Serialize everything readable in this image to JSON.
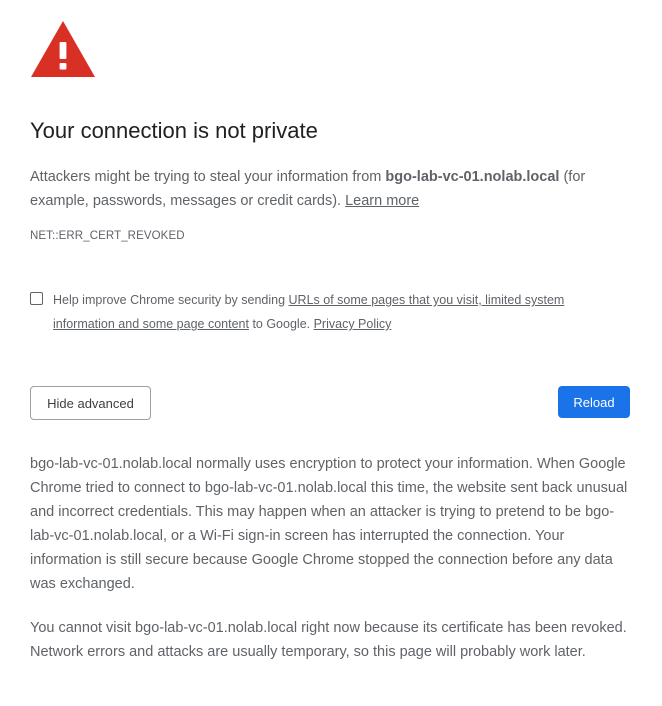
{
  "icon": {
    "name": "warning-triangle-icon",
    "color": "#d93025"
  },
  "title": "Your connection is not private",
  "intro": {
    "before": "Attackers might be trying to steal your information from ",
    "host": "bgo-lab-vc-01.nolab.local",
    "after": " (for example, passwords, messages or credit cards). ",
    "learn_more": "Learn more"
  },
  "error_code": "NET::ERR_CERT_REVOKED",
  "optin": {
    "before": "Help improve Chrome security by sending ",
    "link": "URLs of some pages that you visit, limited system information and some page content",
    "middle": " to Google. ",
    "privacy_link": "Privacy Policy"
  },
  "buttons": {
    "hide_advanced": "Hide advanced",
    "reload": "Reload"
  },
  "details": {
    "paragraph1": "bgo-lab-vc-01.nolab.local normally uses encryption to protect your information. When Google Chrome tried to connect to bgo-lab-vc-01.nolab.local this time, the website sent back unusual and incorrect credentials. This may happen when an attacker is trying to pretend to be bgo-lab-vc-01.nolab.local, or a Wi-Fi sign-in screen has interrupted the connection. Your information is still secure because Google Chrome stopped the connection before any data was exchanged.",
    "paragraph2": "You cannot visit bgo-lab-vc-01.nolab.local right now because its certificate has been revoked. Network errors and attacks are usually temporary, so this page will probably work later."
  },
  "colors": {
    "accent": "#1a73e8",
    "danger": "#d93025",
    "text": "#5f6368",
    "heading": "#202124"
  }
}
